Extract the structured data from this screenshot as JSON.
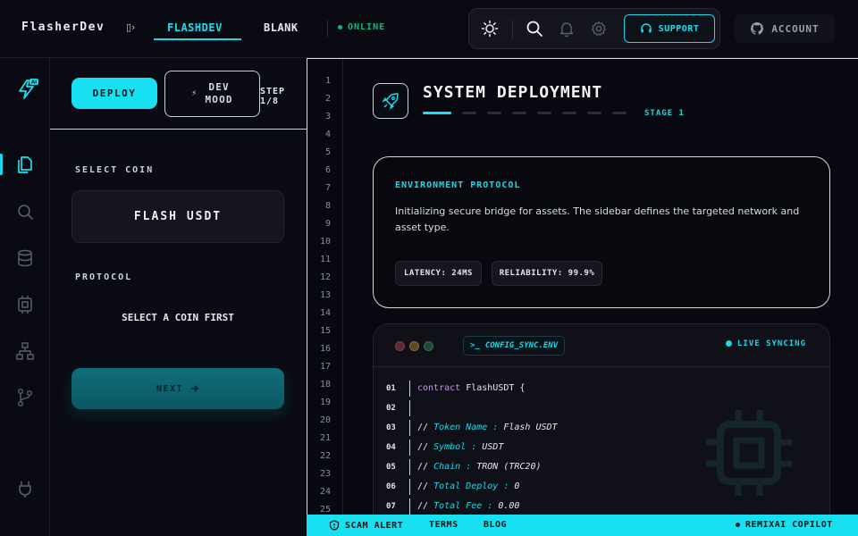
{
  "header": {
    "brand": "FlasherDev",
    "crumb": "▯›",
    "tabs": [
      {
        "label": "FLASHDEV",
        "active": true
      },
      {
        "label": "BLANK",
        "active": false
      }
    ],
    "status": "ONLINE",
    "toolbar": {
      "icons": [
        "sun-icon",
        "search-icon",
        "bell-icon",
        "gear-icon"
      ],
      "support_label": "SUPPORT"
    },
    "account_label": "ACCOUNT"
  },
  "rail": {
    "logo_badge": "AI",
    "items": [
      "files-icon",
      "search-icon",
      "database-icon",
      "chip-icon",
      "network-icon",
      "git-branch-icon"
    ],
    "bottom": "plug-icon"
  },
  "panel": {
    "deploy_label": "DEPLOY",
    "devmood_line1": "DEV",
    "devmood_line2": "MOOD",
    "step_label": "STEP 1/8",
    "select_coin_label": "SELECT COIN",
    "coin_value": "FLASH USDT",
    "protocol_label": "PROTOCOL",
    "protocol_placeholder": "SELECT A COIN FIRST",
    "next_label": "NEXT"
  },
  "main": {
    "line_numbers": [
      "1",
      "2",
      "3",
      "4",
      "5",
      "6",
      "7",
      "8",
      "9",
      "10",
      "11",
      "12",
      "13",
      "14",
      "15",
      "16",
      "17",
      "18",
      "19",
      "20",
      "21",
      "22",
      "23",
      "24",
      "25"
    ],
    "title": "SYSTEM DEPLOYMENT",
    "stage_label": "STAGE 1",
    "stage_progress": 0.125,
    "env": {
      "title": "ENVIRONMENT PROTOCOL",
      "text": "Initializing secure bridge for assets. The sidebar defines the targeted network and asset type.",
      "latency": "LATENCY: 24MS",
      "reliability": "RELIABILITY: 99.9%"
    },
    "code": {
      "file": "CONFIG_SYNC.ENV",
      "status": "LIVE SYNCING",
      "lines": [
        {
          "no": "01",
          "kw": "contract",
          "plain": " FlashUSDT {",
          "cm": "",
          "val": ""
        },
        {
          "no": "02",
          "kw": "",
          "plain": "",
          "cm": "",
          "val": ""
        },
        {
          "no": "03",
          "kw": "",
          "plain": "// ",
          "cm": "Token Name :",
          "val": " Flash USDT"
        },
        {
          "no": "04",
          "kw": "",
          "plain": "// ",
          "cm": "Symbol :",
          "val": " USDT"
        },
        {
          "no": "05",
          "kw": "",
          "plain": "// ",
          "cm": "Chain :",
          "val": " TRON (TRC20)"
        },
        {
          "no": "06",
          "kw": "",
          "plain": "// ",
          "cm": "Total Deploy :",
          "val": " 0"
        },
        {
          "no": "07",
          "kw": "",
          "plain": "// ",
          "cm": "Total Fee :",
          "val": " 0.00"
        }
      ]
    }
  },
  "footer": {
    "scam_alert": "SCAM ALERT",
    "terms": "TERMS",
    "blog": "BLOG",
    "copilot": "REMIXAI COPILOT"
  },
  "colors": {
    "accent": "#19e0f0",
    "online": "#16b57a",
    "keyword": "#c792ea"
  }
}
